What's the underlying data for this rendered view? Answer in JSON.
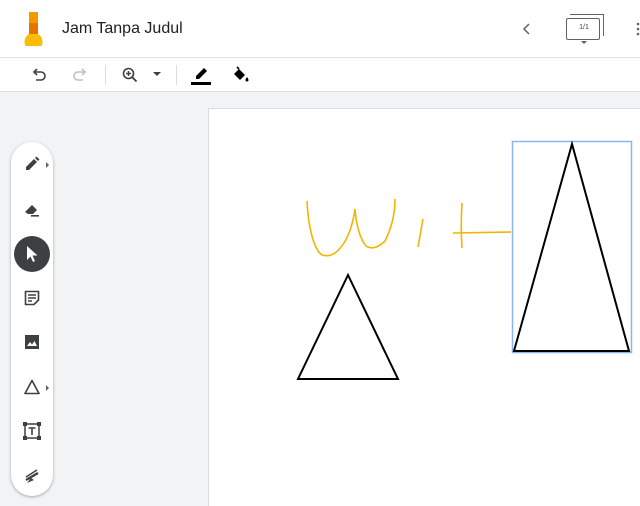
{
  "app": {
    "title": "Jam Tanpa Judul",
    "logo_icon": "jamboard-logo-icon"
  },
  "header": {
    "prev_frame_icon": "chevron-left-icon",
    "frame_counter": "1/1"
  },
  "toolbar": {
    "undo_icon": "undo-icon",
    "redo_icon": "redo-icon",
    "zoom_icon": "zoom-in-icon",
    "pen_color_icon": "pen-color-icon",
    "fill_icon": "fill-bucket-icon"
  },
  "tools": [
    {
      "name": "pen",
      "icon": "pen-icon",
      "active": false
    },
    {
      "name": "eraser",
      "icon": "eraser-icon",
      "active": false
    },
    {
      "name": "select",
      "icon": "select-cursor-icon",
      "active": true
    },
    {
      "name": "sticky-note",
      "icon": "sticky-note-icon",
      "active": false
    },
    {
      "name": "add-image",
      "icon": "image-icon",
      "active": false
    },
    {
      "name": "shape",
      "icon": "triangle-shape-icon",
      "active": false
    },
    {
      "name": "text-box",
      "icon": "text-box-icon",
      "active": false
    },
    {
      "name": "laser",
      "icon": "laser-pointer-icon",
      "active": false
    }
  ],
  "colors": {
    "accent_ink": "#f4b400",
    "stroke": "#000000",
    "selection": "#8ab4f8",
    "active_tool_bg": "#3c4043"
  }
}
